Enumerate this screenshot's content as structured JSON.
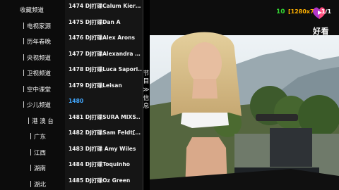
{
  "categories": [
    {
      "label": "收藏频道",
      "level": 1
    },
    {
      "label": "电视家源",
      "level": 2
    },
    {
      "label": "历年春晚",
      "level": 2
    },
    {
      "label": "央视频道",
      "level": 2
    },
    {
      "label": "卫视频道",
      "level": 2
    },
    {
      "label": "空中课堂",
      "level": 2
    },
    {
      "label": "少儿频道",
      "level": 2
    },
    {
      "label": "港 澳 台",
      "level": 3
    },
    {
      "label": "广东",
      "level": 4
    },
    {
      "label": "江西",
      "level": 4
    },
    {
      "label": "湖南",
      "level": 4
    },
    {
      "label": "湖北",
      "level": 4
    }
  ],
  "channels": [
    {
      "label": "1474 DJ打碟Calum Kieran",
      "active": false
    },
    {
      "label": "1475 DJ打碟Dan A",
      "active": false
    },
    {
      "label": "1476 DJ打碟Alex Arons",
      "active": false
    },
    {
      "label": "1477 DJ打碟Alexandra B..",
      "active": false
    },
    {
      "label": "1478 DJ打碟Luca Sapori..",
      "active": false
    },
    {
      "label": "1479 DJ打碟Leisan",
      "active": false
    },
    {
      "label": "1480",
      "active": true
    },
    {
      "label": "1481 DJ打碟SURA MIXS..",
      "active": false
    },
    {
      "label": "1482 DJ打碟Sam Feldt[1..",
      "active": false
    },
    {
      "label": "1483 DJ打碟 Amy Wiles",
      "active": false
    },
    {
      "label": "1484 DJ打碟Toquinho",
      "active": false
    },
    {
      "label": "1485 DJ打碟Oz Green",
      "active": false
    }
  ],
  "side_tab": {
    "top": "节",
    "mid": "目",
    "arrow": "≫",
    "b1": "信",
    "b2": "息"
  },
  "overlay": {
    "channel_number": "10",
    "resolution": "[1280x720]",
    "page": "1/1",
    "logo_text": "好看"
  },
  "colors": {
    "active_channel": "#42a8ff",
    "channel_number": "#33d633",
    "resolution": "#ffb000"
  }
}
